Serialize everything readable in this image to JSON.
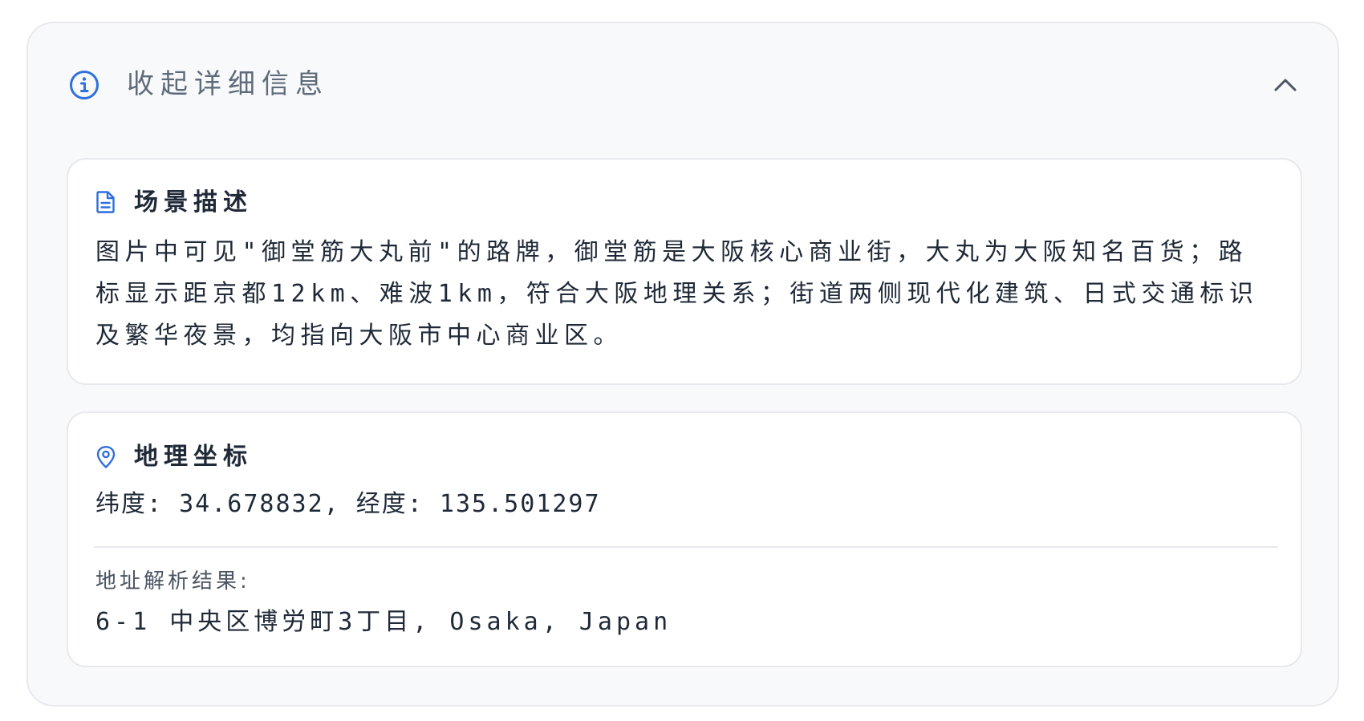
{
  "header": {
    "title": "收起详细信息",
    "info_icon": "info-circle-icon",
    "toggle_icon": "chevron-up-icon"
  },
  "scene": {
    "title": "场景描述",
    "icon": "document-icon",
    "text": "图片中可见\"御堂筋大丸前\"的路牌，御堂筋是大阪核心商业街，大丸为大阪知名百货；路标显示距京都12km、难波1km，符合大阪地理关系；街道两侧现代化建筑、日式交通标识及繁华夜景，均指向大阪市中心商业区。"
  },
  "geo": {
    "title": "地理坐标",
    "icon": "location-pin-icon",
    "coordinates": "纬度: 34.678832, 经度: 135.501297",
    "address_label": "地址解析结果:",
    "address": "6-1 中央区博労町3丁目, Osaka, Japan"
  },
  "colors": {
    "accent": "#2f6fde",
    "panel_background": "#f8f9fb",
    "card_background": "#ffffff",
    "border": "#e7e9ee",
    "muted_text": "#5f6b7a",
    "body_text": "#1f2937"
  }
}
